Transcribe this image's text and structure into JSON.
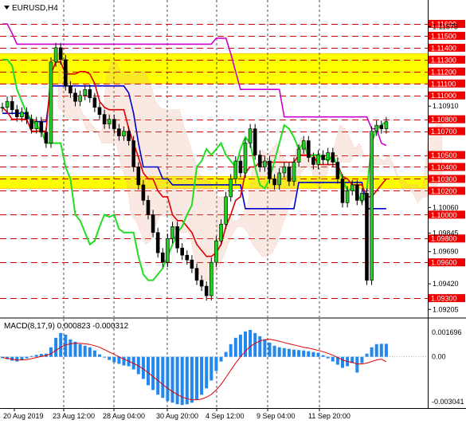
{
  "chart_data": [
    {
      "type": "line",
      "title": "EURUSD,H4",
      "symbol": "EURUSD",
      "timeframe": "H4",
      "ylim": [
        1.0918,
        1.1168
      ],
      "price_labels": [
        "1.11600",
        "1.11575",
        "1.11500",
        "1.11400",
        "1.11300",
        "1.11200",
        "1.11100",
        "1.11000",
        "1.10910",
        "1.10800",
        "1.10700",
        "1.10500",
        "1.10400",
        "1.10300",
        "1.10200",
        "1.10060",
        "1.10000",
        "1.09845",
        "1.09800",
        "1.09690",
        "1.09600",
        "1.09420",
        "1.09300",
        "1.09205"
      ],
      "highlighted_levels": [
        {
          "label": "1.11600",
          "value": 1.116
        },
        {
          "label": "1.11500",
          "value": 1.115
        },
        {
          "label": "1.11400",
          "value": 1.114
        },
        {
          "label": "1.11300",
          "value": 1.113
        },
        {
          "label": "1.11200",
          "value": 1.112
        },
        {
          "label": "1.11100",
          "value": 1.111
        },
        {
          "label": "1.11000",
          "value": 1.11
        },
        {
          "label": "1.10800",
          "value": 1.108
        },
        {
          "label": "1.10700",
          "value": 1.107
        },
        {
          "label": "1.10500",
          "value": 1.105
        },
        {
          "label": "1.10400",
          "value": 1.104
        },
        {
          "label": "1.10300",
          "value": 1.103
        },
        {
          "label": "1.10200",
          "value": 1.102
        },
        {
          "label": "1.10000",
          "value": 1.1
        },
        {
          "label": "1.09800",
          "value": 1.098
        },
        {
          "label": "1.09600",
          "value": 1.096
        },
        {
          "label": "1.09300",
          "value": 1.093
        }
      ],
      "plain_levels": [
        "1.11575",
        "1.10910",
        "1.10060",
        "1.09845",
        "1.09690",
        "1.09420",
        "1.09205"
      ],
      "resistance_zones": [
        [
          1.111,
          1.1135
        ],
        [
          1.1022,
          1.1032
        ]
      ],
      "x_tick_labels": [
        "20 Aug 2019",
        "23 Aug 12:00",
        "28 Aug 04:00",
        "30 Aug 20:00",
        "4 Sep 12:00",
        "9 Sep 04:00",
        "11 Sep 20:00"
      ],
      "close_series": [
        1.109,
        1.1095,
        1.1088,
        1.1082,
        1.1086,
        1.108,
        1.1072,
        1.1078,
        1.1069,
        1.106,
        1.1128,
        1.114,
        1.113,
        1.1108,
        1.1102,
        1.1095,
        1.11,
        1.1105,
        1.1098,
        1.109,
        1.1084,
        1.1076,
        1.108,
        1.1072,
        1.1066,
        1.107,
        1.1062,
        1.104,
        1.1025,
        1.1012,
        1.1,
        1.0985,
        1.0968,
        1.096,
        1.098,
        1.099,
        1.0972,
        1.0966,
        1.0962,
        1.0955,
        1.0945,
        1.094,
        1.0932,
        1.096,
        1.0978,
        1.0992,
        1.1015,
        1.103,
        1.1045,
        1.1035,
        1.106,
        1.1072,
        1.105,
        1.104,
        1.1045,
        1.103,
        1.1025,
        1.1035,
        1.104,
        1.1028,
        1.1044,
        1.1055,
        1.1062,
        1.1048,
        1.1042,
        1.105,
        1.1046,
        1.1052,
        1.1044,
        1.103,
        1.101,
        1.102,
        1.1025,
        1.1012,
        1.1018,
        1.0945,
        1.107,
        1.1075,
        1.1072,
        1.1078
      ],
      "series": [
        {
          "color": "#cc00cc",
          "values": [
            1.116,
            1.116,
            1.1152,
            1.1143,
            1.1143,
            1.1143,
            1.1143,
            1.1143,
            1.1143,
            1.1143,
            1.1143,
            1.1143,
            1.1143,
            1.1143,
            1.1143,
            1.1143,
            1.1143,
            1.1143,
            1.1143,
            1.1143,
            1.1143,
            1.1143,
            1.1143,
            1.1143,
            1.1143,
            1.1143,
            1.1143,
            1.1143,
            1.1143,
            1.1143,
            1.1143,
            1.1143,
            1.1143,
            1.1143,
            1.1143,
            1.1143,
            1.1143,
            1.1143,
            1.1143,
            1.1143,
            1.1143,
            1.1143,
            1.1143,
            1.1143,
            1.1148,
            1.1148,
            1.1148,
            1.1135,
            1.112,
            1.1105,
            1.1105,
            1.1105,
            1.1105,
            1.1105,
            1.1105,
            1.1105,
            1.1105,
            1.1105,
            1.1082,
            1.1082,
            1.1082,
            1.1082,
            1.1082,
            1.1082,
            1.1082,
            1.1082,
            1.1082,
            1.1082,
            1.1082,
            1.1082,
            1.1082,
            1.1082,
            1.1082,
            1.1082,
            1.1082,
            1.1082,
            1.1072,
            1.1072,
            1.106,
            1.1058
          ]
        },
        {
          "color": "#0000cc",
          "values": [
            1.1085,
            1.1085,
            1.1085,
            1.1085,
            1.1085,
            1.1085,
            1.1078,
            1.1078,
            1.1078,
            1.1078,
            1.1108,
            1.1108,
            1.1108,
            1.1108,
            1.1108,
            1.1108,
            1.1108,
            1.1108,
            1.1108,
            1.1108,
            1.1108,
            1.1108,
            1.1108,
            1.1108,
            1.1108,
            1.1108,
            1.1102,
            1.1085,
            1.106,
            1.104,
            1.104,
            1.104,
            1.104,
            1.103,
            1.103,
            1.1025,
            1.1025,
            1.1025,
            1.1025,
            1.1025,
            1.1025,
            1.1025,
            1.1025,
            1.1025,
            1.1025,
            1.1025,
            1.1025,
            1.1025,
            1.1025,
            1.1025,
            1.1005,
            1.1005,
            1.1005,
            1.1005,
            1.1005,
            1.1005,
            1.1005,
            1.1005,
            1.1005,
            1.1005,
            1.1005,
            1.1027,
            1.1027,
            1.1027,
            1.1027,
            1.1027,
            1.1027,
            1.1027,
            1.1027,
            1.1027,
            1.1027,
            1.1027,
            1.1027,
            1.1027,
            1.1027,
            1.1005,
            1.1005,
            1.1005,
            1.1005,
            1.1005
          ]
        },
        {
          "color": "#dd0000",
          "values": [
            1.109,
            1.1086,
            1.108,
            1.108,
            1.108,
            1.108,
            1.107,
            1.107,
            1.107,
            1.107,
            1.1118,
            1.1128,
            1.1128,
            1.1118,
            1.1118,
            1.1118,
            1.112,
            1.112,
            1.1118,
            1.111,
            1.1095,
            1.109,
            1.1088,
            1.1088,
            1.1088,
            1.1088,
            1.1072,
            1.106,
            1.1048,
            1.1035,
            1.103,
            1.103,
            1.102,
            1.1015,
            1.1015,
            1.1,
            1.0995,
            1.0995,
            1.099,
            1.0985,
            1.0975,
            1.097,
            1.0965,
            1.0965,
            1.0968,
            1.0975,
            1.099,
            1.1,
            1.1012,
            1.1015,
            1.1035,
            1.104,
            1.104,
            1.1044,
            1.1044,
            1.1044,
            1.1044,
            1.1044,
            1.1044,
            1.1044,
            1.1044,
            1.105,
            1.105,
            1.105,
            1.105,
            1.1042,
            1.1042,
            1.1042,
            1.1042,
            1.1042,
            1.1032,
            1.103,
            1.1025,
            1.1025,
            1.1025,
            1.1015,
            1.1015,
            1.102,
            1.1025,
            1.103
          ]
        },
        {
          "color": "#22dd22",
          "values": [
            1.113,
            1.113,
            1.1125,
            1.1105,
            1.1095,
            1.1085,
            1.108,
            1.1075,
            1.107,
            1.106,
            1.106,
            1.106,
            1.106,
            1.104,
            1.103,
            1.1,
            1.0995,
            1.0985,
            1.0975,
            1.0978,
            1.099,
            1.1,
            1.0998,
            1.1,
            1.0988,
            1.0985,
            1.0985,
            1.0985,
            1.0965,
            1.095,
            1.0945,
            1.0945,
            1.095,
            1.0955,
            1.0965,
            1.0975,
            1.0985,
            1.099,
            1.1,
            1.1008,
            1.104,
            1.1045,
            1.1055,
            1.105,
            1.1055,
            1.106,
            1.105,
            1.1045,
            1.104,
            1.1055,
            1.1065,
            1.106,
            1.104,
            1.1025,
            1.1022,
            1.103,
            1.1045,
            1.106,
            1.1075,
            1.1072,
            1.1065,
            1.1055,
            1.106,
            1.1048,
            1.105,
            1.105,
            1.1048,
            1.1045,
            1.105,
            1.104,
            1.103,
            1.102,
            1.1022,
            1.1018,
            1.101,
            1.102,
            1.106,
            1.1072,
            1.1075,
            1.1078
          ]
        }
      ]
    },
    {
      "type": "bar",
      "title": "MACD(8,17,9) 0.000823 -0.000312",
      "indicator": "MACD(8,17,9)",
      "main_value": "0.000823",
      "signal_value": "-0.000312",
      "ylim": [
        -0.003041,
        0.001696
      ],
      "y_tick_labels": [
        "0.001696",
        "0.00",
        "-0.003041"
      ],
      "values": [
        -8e-05,
        -0.00015,
        -0.00025,
        -0.0003,
        -0.0002,
        -0.0001,
        5e-05,
        0.00012,
        0.00018,
        0.0002,
        0.0006,
        0.0012,
        0.0015,
        0.0014,
        0.0011,
        0.00095,
        0.0008,
        0.0007,
        0.0006,
        0.0004,
        0.00015,
        -5e-05,
        -0.0002,
        -0.00035,
        -0.00045,
        -0.00055,
        -0.0006,
        -0.0008,
        -0.0011,
        -0.0014,
        -0.0018,
        -0.0021,
        -0.0024,
        -0.0026,
        -0.0028,
        -0.0029,
        -0.003,
        -0.00305,
        -0.003,
        -0.0029,
        -0.0027,
        -0.0024,
        -0.002,
        -0.0015,
        -0.0009,
        -0.0003,
        0.0003,
        0.0008,
        0.0012,
        0.0014,
        0.0016,
        0.0017,
        0.0015,
        0.0013,
        0.0011,
        0.0009,
        0.0007,
        0.0006,
        0.00055,
        0.0005,
        0.00045,
        0.00042,
        0.0004,
        0.00035,
        0.0003,
        0.00025,
        0.0001,
        -0.0001,
        -0.0003,
        -0.0005,
        -0.0007,
        -0.0006,
        -0.0004,
        -0.001,
        -0.0004,
        0.0002,
        0.0006,
        0.0008,
        0.00082,
        0.00082
      ],
      "signal_series": [
        -5e-05,
        -0.0001,
        -0.00015,
        -0.0002,
        -0.0002,
        -0.00018,
        -0.00012,
        -5e-05,
        3e-05,
        8e-05,
        0.0002,
        0.0004,
        0.0006,
        0.00075,
        0.00082,
        0.00085,
        0.00085,
        0.00082,
        0.00078,
        0.0007,
        0.0006,
        0.00045,
        0.0003,
        0.00015,
        0.0,
        -0.00015,
        -0.00028,
        -0.00042,
        -0.00058,
        -0.00078,
        -0.001,
        -0.00125,
        -0.0015,
        -0.00175,
        -0.002,
        -0.0022,
        -0.00238,
        -0.00255,
        -0.00265,
        -0.00272,
        -0.00272,
        -0.00268,
        -0.00255,
        -0.00238,
        -0.0021,
        -0.00175,
        -0.0013,
        -0.00085,
        -0.0004,
        0.0,
        0.00035,
        0.00065,
        0.00085,
        0.001,
        0.00108,
        0.0011,
        0.00105,
        0.00098,
        0.0009,
        0.00082,
        0.00075,
        0.00068,
        0.0006,
        0.00055,
        0.00048,
        0.0004,
        0.00032,
        0.00022,
        0.0001,
        -5e-05,
        -0.0002,
        -0.0003,
        -0.00035,
        -0.00045,
        -0.00045,
        -0.0004,
        -0.0003,
        -0.0002,
        -0.00015,
        -0.00031
      ]
    }
  ],
  "colors": {
    "background": "#ffffff",
    "grid": "#000000",
    "level_line": "#cc0000",
    "level_tag": "#ee0000",
    "zone": "#ffff00",
    "zone_edge": "#ffcc00",
    "bullish_candle": "#22cc22",
    "macd_histogram": "#2288ee",
    "macd_signal": "#dd0000",
    "ichimoku_cloud": "#e6a98a"
  },
  "icons": {
    "symbol_menu": "triangle-down-icon"
  }
}
